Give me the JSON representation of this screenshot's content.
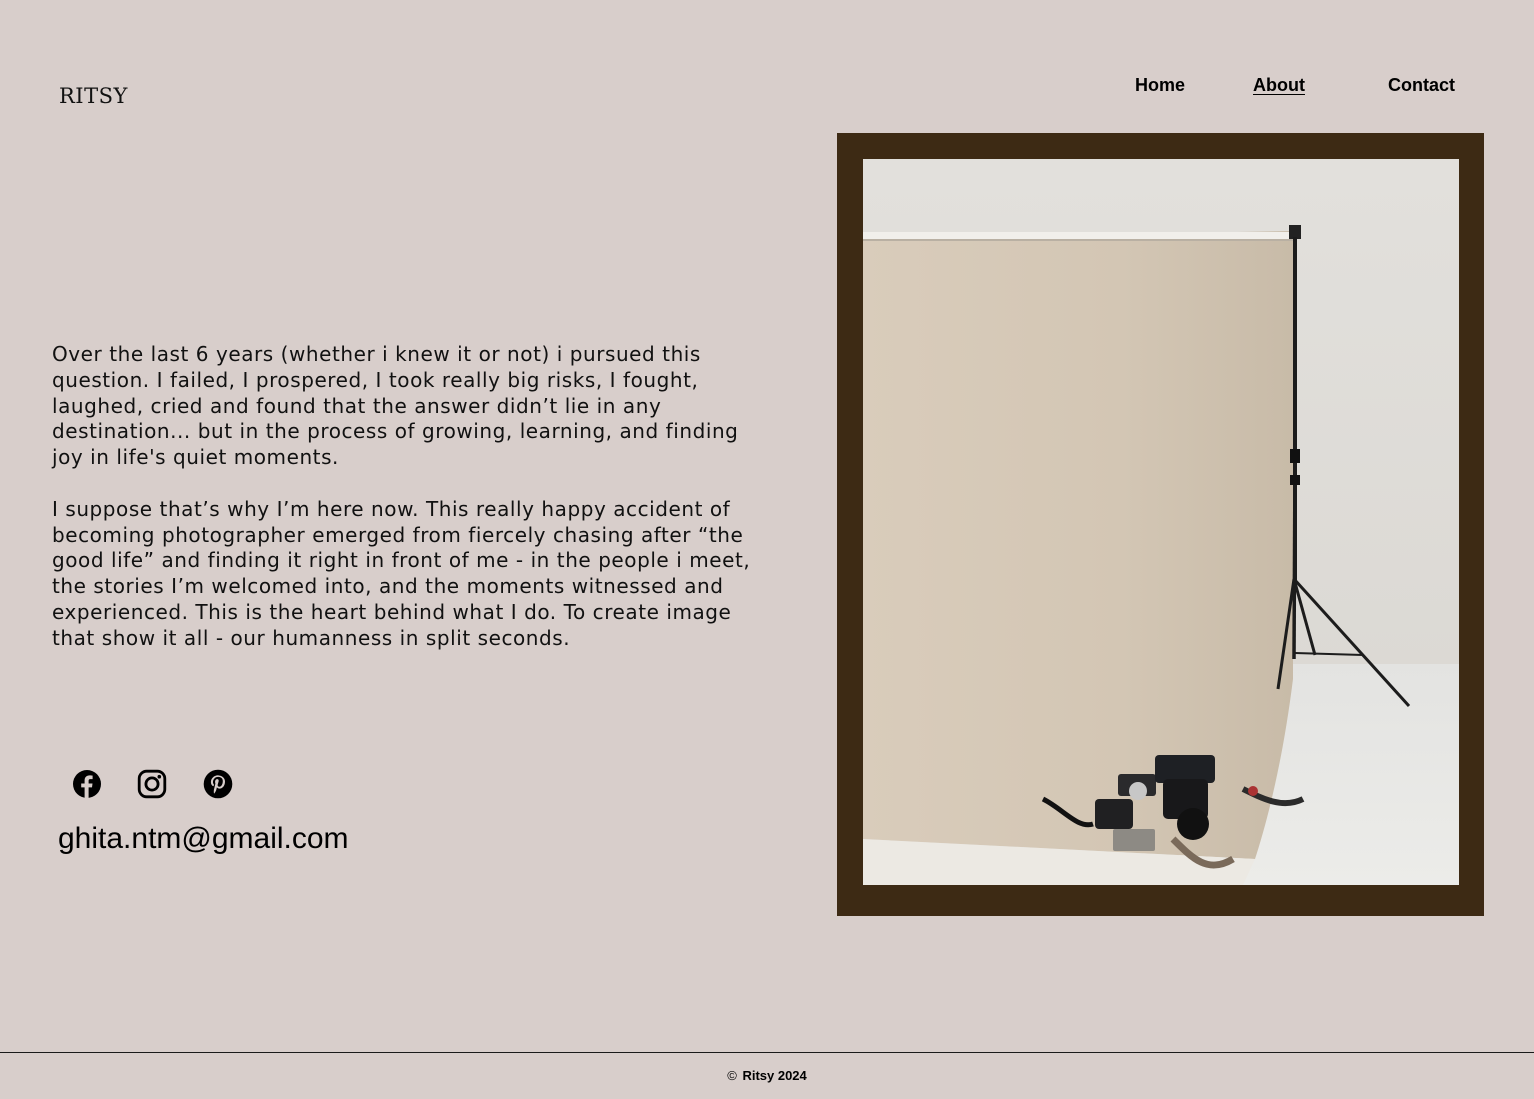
{
  "site": {
    "logo": "RITSY"
  },
  "nav": {
    "items": [
      {
        "label": "Home",
        "active": false
      },
      {
        "label": "About",
        "active": true
      },
      {
        "label": "Contact",
        "active": false
      }
    ]
  },
  "bio": {
    "paragraphs": [
      "Over the last 6 years (whether i knew it or not) i pursued this question. I failed, I prospered, I took really big risks, I fought, laughed, cried and found that the answer didn’t lie in any destination... but in the process of growing, learning, and finding joy in life's quiet moments.",
      "I suppose that’s why I’m here now. This really happy accident of becoming photographer emerged from fiercely chasing after “the good life” and finding it right in front of me - in the people i meet, the stories I’m welcomed into, and the moments witnessed and experienced. This is the heart behind what I do. To create image that show it all - our humanness in split seconds."
    ]
  },
  "social": {
    "icons": [
      "facebook-icon",
      "instagram-icon",
      "pinterest-icon"
    ]
  },
  "contact": {
    "email": "ghita.ntm@gmail.com"
  },
  "photo": {
    "frame_color": "#3d2a14"
  },
  "footer": {
    "copyright_symbol": "©",
    "text": "Ritsy 2024"
  },
  "colors": {
    "background": "#d8cecb",
    "text": "#000000"
  }
}
